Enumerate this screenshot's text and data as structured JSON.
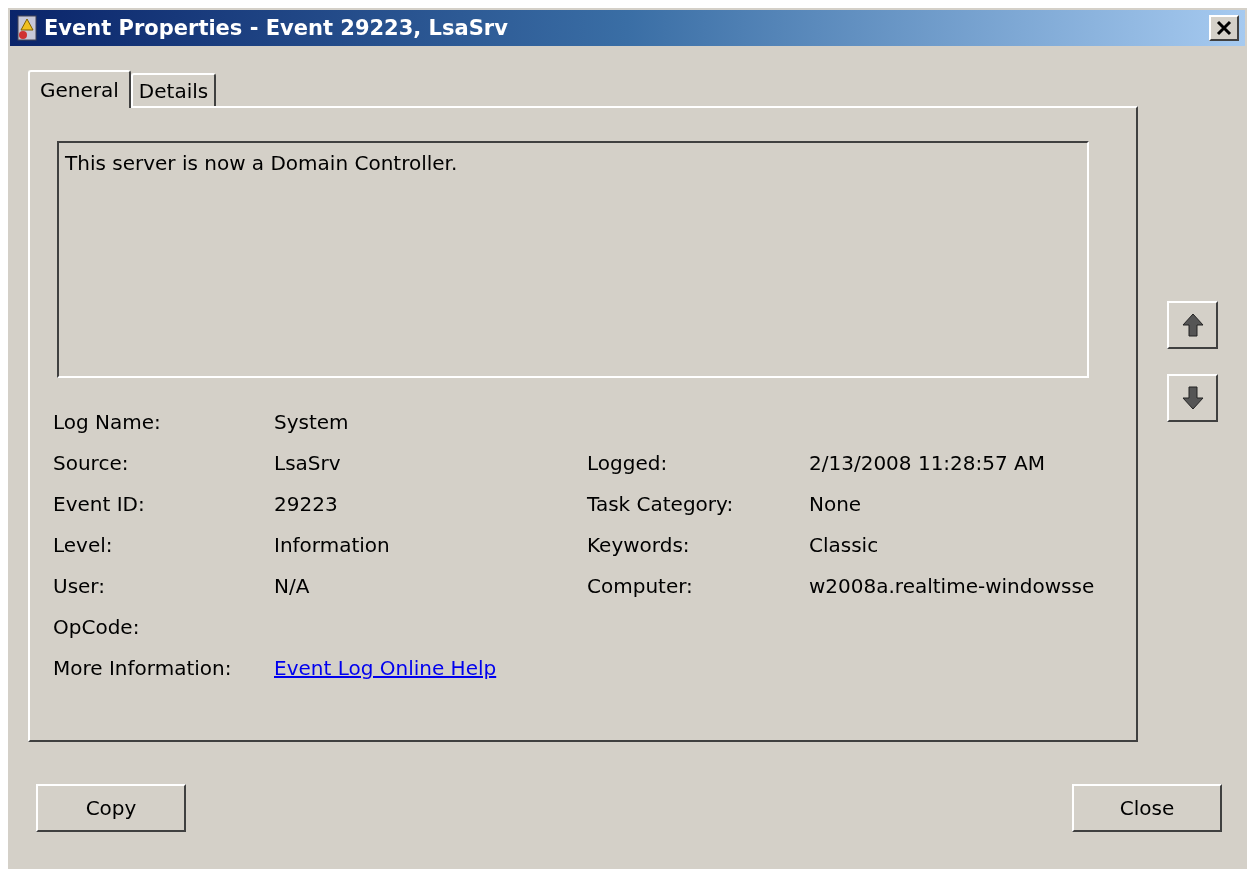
{
  "window": {
    "title": "Event Properties - Event 29223, LsaSrv"
  },
  "tabs": [
    {
      "label": "General",
      "selected": true
    },
    {
      "label": "Details",
      "selected": false
    }
  ],
  "message": "This server is now a Domain Controller.",
  "rows": [
    {
      "left": {
        "label": "Log Name:",
        "value": "System"
      }
    },
    {
      "left": {
        "label": "Source:",
        "value": "LsaSrv"
      },
      "right": {
        "label": "Logged:",
        "value": "2/13/2008 11:28:57 AM"
      }
    },
    {
      "left": {
        "label": "Event ID:",
        "value": "29223"
      },
      "right": {
        "label": "Task Category:",
        "value": "None"
      }
    },
    {
      "left": {
        "label": "Level:",
        "value": "Information"
      },
      "right": {
        "label": "Keywords:",
        "value": "Classic"
      }
    },
    {
      "left": {
        "label": "User:",
        "value": "N/A"
      },
      "right": {
        "label": "Computer:",
        "value": "w2008a.realtime-windowsse"
      }
    },
    {
      "left": {
        "label": "OpCode:"
      }
    },
    {
      "left": {
        "label": "More Information:",
        "value": "Event Log Online Help",
        "kind": "link"
      }
    }
  ],
  "buttons": [
    "Copy",
    "Close"
  ]
}
